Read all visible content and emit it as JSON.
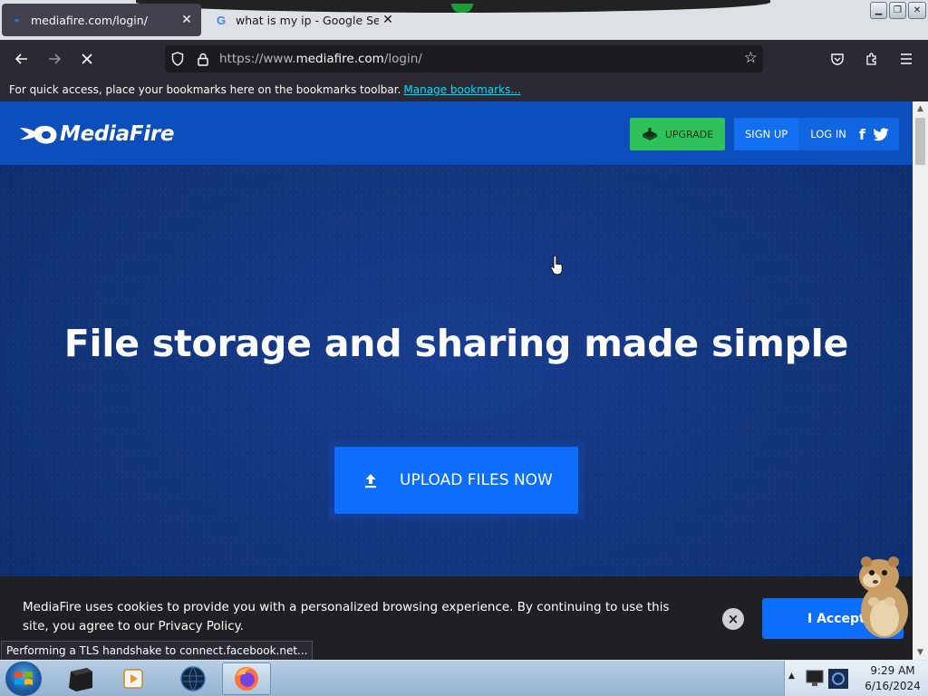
{
  "browser": {
    "tabs": [
      {
        "title": "mediafire.com/login/",
        "active": true,
        "favicon": "mediafire-favicon-icon"
      },
      {
        "title": "what is my ip - Google Search",
        "active": false,
        "favicon": "google-g-icon"
      }
    ],
    "url_prefix": "https://www.",
    "url_domain": "mediafire.com",
    "url_path": "/login/",
    "bookmarks_hint": "For quick access, place your bookmarks here on the bookmarks toolbar.",
    "manage_bookmarks": "Manage bookmarks...",
    "status_text": "Performing a TLS handshake to connect.facebook.net..."
  },
  "site": {
    "brand": "MediaFire",
    "nav": {
      "upgrade": "UPGRADE",
      "signup": "SIGN UP",
      "login": "LOG IN",
      "facebook": "f"
    },
    "headline": "File storage and sharing made simple",
    "upload_label": "UPLOAD FILES NOW",
    "cookie_message": "MediaFire uses cookies to provide you with a personalized browsing experience. By continuing to use this site, you agree to our Privacy Policy.",
    "cookie_accept": "I Accept",
    "cookie_close": "×"
  },
  "taskbar": {
    "time": "9:29 AM",
    "date": "6/16/2024",
    "apps": [
      "terminal-icon",
      "media-player-icon",
      "globe-icon",
      "firefox-icon"
    ]
  },
  "colors": {
    "mf_header": "#0c4ebc",
    "mf_hero": "#12347a",
    "upgrade_green": "#2fc25a",
    "accent_blue": "#0d6efd",
    "tab_active": "#42414d"
  }
}
